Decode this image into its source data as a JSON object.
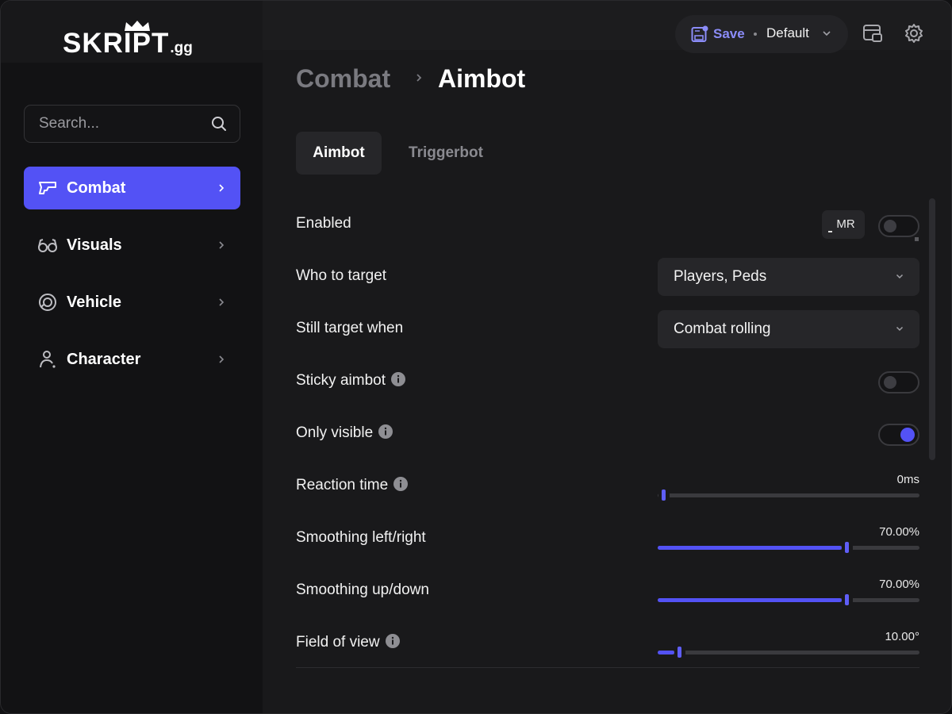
{
  "app": {
    "logo_text": "SKRIPT",
    "logo_suffix": ".gg"
  },
  "sidebar": {
    "search": {
      "placeholder": "Search..."
    },
    "items": [
      {
        "label": "Combat",
        "icon": "gun-icon",
        "active": true
      },
      {
        "label": "Visuals",
        "icon": "glasses-icon",
        "active": false
      },
      {
        "label": "Vehicle",
        "icon": "steering-wheel-icon",
        "active": false
      },
      {
        "label": "Character",
        "icon": "user-icon",
        "active": false
      }
    ]
  },
  "header": {
    "save_label": "Save",
    "profile": "Default"
  },
  "breadcrumb": {
    "parent": "Combat",
    "current": "Aimbot"
  },
  "tabs": [
    {
      "label": "Aimbot",
      "active": true
    },
    {
      "label": "Triggerbot",
      "active": false
    }
  ],
  "settings": {
    "enabled": {
      "label": "Enabled",
      "keybind": "MR",
      "on": false
    },
    "who_to_target": {
      "label": "Who to target",
      "value": "Players, Peds"
    },
    "still_target_when": {
      "label": "Still target when",
      "value": "Combat rolling"
    },
    "sticky_aimbot": {
      "label": "Sticky aimbot",
      "on": false
    },
    "only_visible": {
      "label": "Only visible",
      "on": true
    },
    "reaction_time": {
      "label": "Reaction time",
      "value_text": "0ms",
      "fraction": 0.0
    },
    "smoothing_lr": {
      "label": "Smoothing left/right",
      "value_text": "70.00%",
      "fraction": 0.7
    },
    "smoothing_ud": {
      "label": "Smoothing up/down",
      "value_text": "70.00%",
      "fraction": 0.7
    },
    "fov": {
      "label": "Field of view",
      "value_text": "10.00°",
      "fraction": 0.06
    }
  },
  "colors": {
    "accent": "#5352f5",
    "background": "#19191b",
    "sidebar": "#121214"
  }
}
